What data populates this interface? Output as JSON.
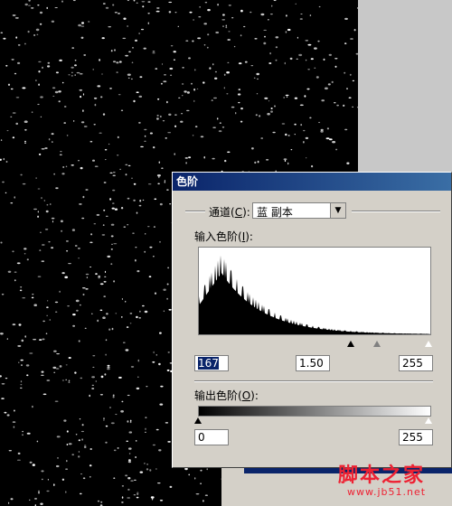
{
  "dialog": {
    "title": "色阶",
    "channel_label_prefix": "通道(",
    "channel_label_key": "C",
    "channel_label_suffix": "):",
    "channel_value": "蓝 副本",
    "input_levels_label_prefix": "输入色阶(",
    "input_levels_key": "I",
    "input_levels_label_suffix": "):",
    "input_black": "167",
    "input_gamma": "1.50",
    "input_white": "255",
    "output_levels_label_prefix": "输出色阶(",
    "output_levels_key": "O",
    "output_levels_label_suffix": "):",
    "output_black": "0",
    "output_white": "255"
  },
  "watermark": {
    "text": "脚本之家",
    "url": "www.jb51.net"
  },
  "colors": {
    "title_bar": "#0a246a",
    "dialog_bg": "#d4d0c8",
    "watermark": "#e22233"
  }
}
